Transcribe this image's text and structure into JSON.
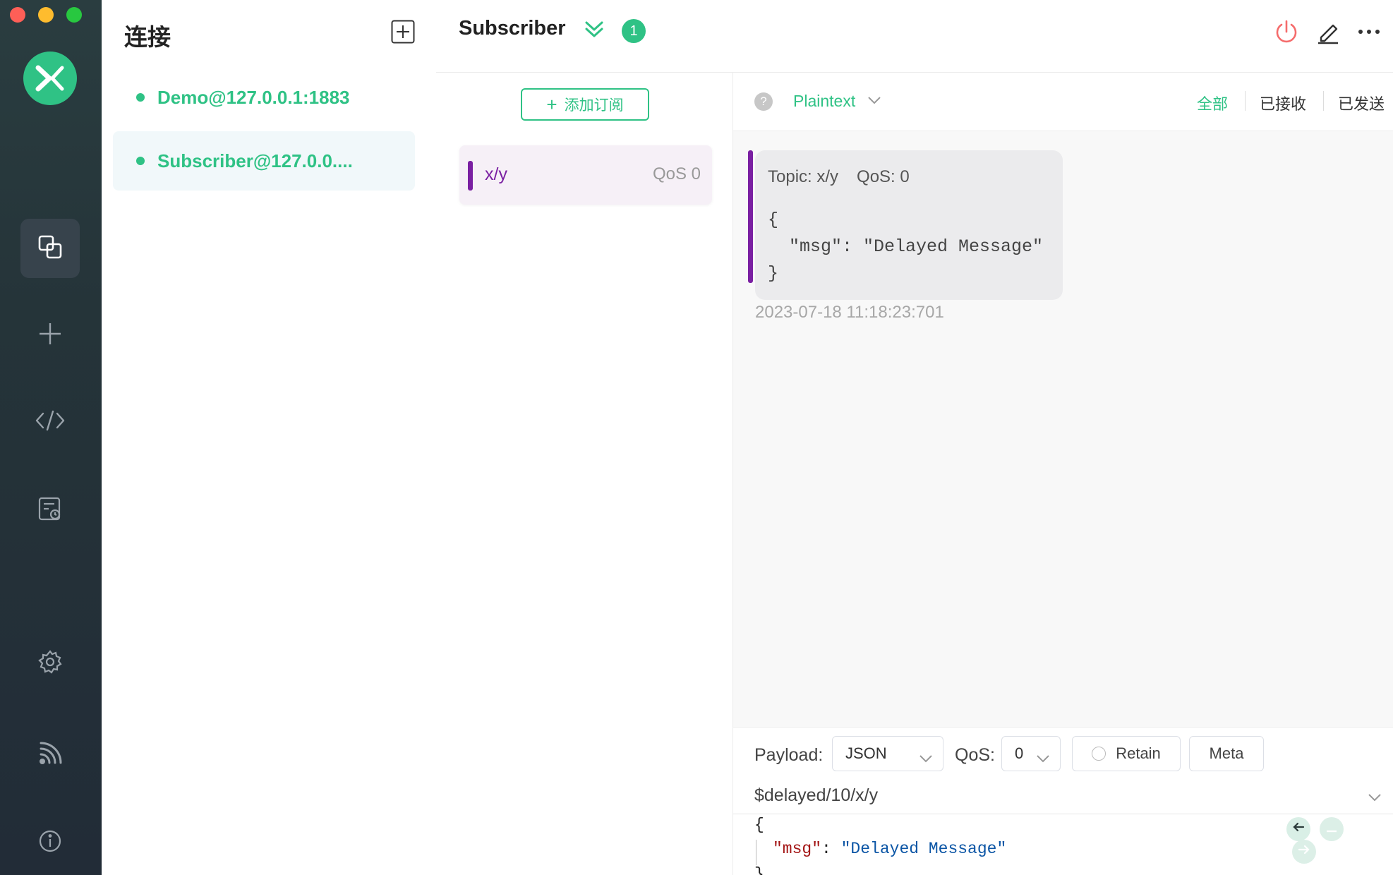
{
  "sidebar": {
    "items": [
      {
        "name": "connections",
        "icon": "connections-icon",
        "active": true
      },
      {
        "name": "new-connection",
        "icon": "plus-icon"
      },
      {
        "name": "script",
        "icon": "code-icon"
      },
      {
        "name": "log",
        "icon": "log-icon"
      },
      {
        "name": "settings",
        "icon": "gear-icon"
      },
      {
        "name": "subscriptions",
        "icon": "feed-icon"
      },
      {
        "name": "about",
        "icon": "info-icon"
      }
    ]
  },
  "connections": {
    "title": "连接",
    "items": [
      {
        "name": "Demo@127.0.0.1:1883",
        "status_color": "#2fc285",
        "selected": false
      },
      {
        "name": "Subscriber@127.0.0....",
        "status_color": "#2fc285",
        "selected": true
      }
    ]
  },
  "header": {
    "title": "Subscriber",
    "badge": "1"
  },
  "subscriptions": {
    "add_label": "添加订阅",
    "items": [
      {
        "topic": "x/y",
        "qos": "QoS 0",
        "color": "#7a1fa2"
      }
    ]
  },
  "messages": {
    "payload_type": "Plaintext",
    "filters": [
      "全部",
      "已接收",
      "已发送"
    ],
    "active_filter": "全部",
    "items": [
      {
        "topic": "Topic: x/y",
        "qos": "QoS: 0",
        "body": "{\n  \"msg\": \"Delayed Message\"\n}",
        "time": "2023-07-18 11:18:23:701"
      }
    ]
  },
  "publish": {
    "payload_label": "Payload:",
    "payload_format": "JSON",
    "qos_label": "QoS:",
    "qos_value": "0",
    "retain_label": "Retain",
    "meta_label": "Meta",
    "topic": "$delayed/10/x/y",
    "editor": {
      "line1": "{",
      "key": "\"msg\"",
      "colon": ": ",
      "value": "\"Delayed Message\"",
      "line3": "}"
    }
  },
  "colors": {
    "accent": "#2fc285",
    "topic_purple": "#7a1fa2",
    "disconnect": "#f56c6c"
  }
}
